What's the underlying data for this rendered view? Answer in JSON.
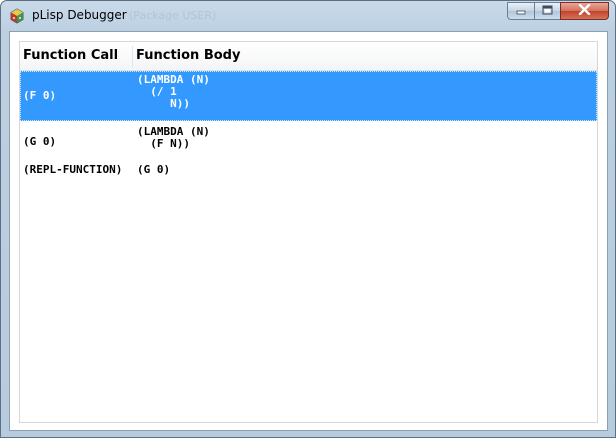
{
  "window": {
    "title": "pLisp Debugger",
    "icon": "plisp-app-icon"
  },
  "controls": {
    "minimize": "minimize-icon",
    "maximize": "maximize-icon",
    "close": "close-icon"
  },
  "table": {
    "columns": [
      "Function Call",
      "Function Body"
    ],
    "rows": [
      {
        "call": "(F 0)",
        "body": "(LAMBDA (N)\n  (/ 1\n     N))",
        "selected": true
      },
      {
        "call": "(G 0)",
        "body": "(LAMBDA (N)\n  (F N))",
        "selected": false
      },
      {
        "call": "(REPL-FUNCTION)",
        "body": "(G 0)",
        "selected": false
      }
    ]
  },
  "colors": {
    "selection": "#3399ff",
    "close_button": "#c2432a",
    "frame": "#bcd0e2"
  }
}
